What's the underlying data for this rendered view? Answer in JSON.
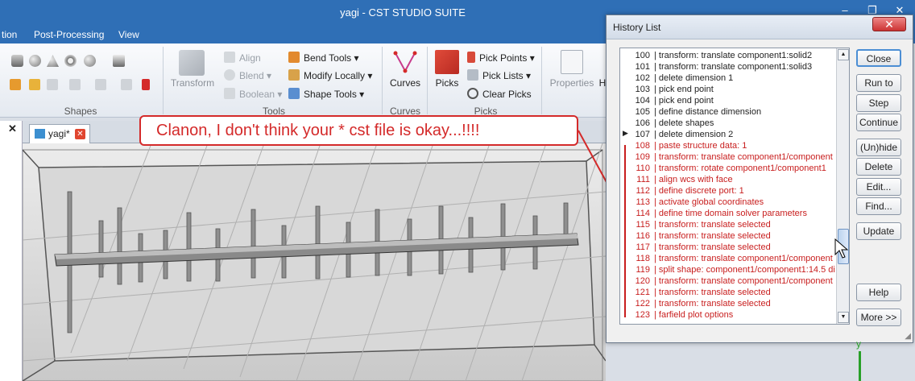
{
  "window": {
    "title": "yagi - CST STUDIO SUITE",
    "minimize": "–",
    "restore": "❐",
    "close": "✕"
  },
  "menu": [
    "tion",
    "Post-Processing",
    "View"
  ],
  "ribbon": {
    "groups": {
      "shapes": "Shapes",
      "tools": "Tools",
      "curves": "Curves",
      "picks": "Picks"
    },
    "transform": "Transform",
    "align": "Align",
    "blend": "Blend",
    "boolean": "Boolean",
    "bend_tools": "Bend Tools",
    "modify_locally": "Modify Locally",
    "shape_tools": "Shape Tools",
    "curves": "Curves",
    "picks": "Picks",
    "pick_points": "Pick Points",
    "pick_lists": "Pick Lists",
    "clear_picks": "Clear Picks",
    "properties": "Properties",
    "cut_label": "H"
  },
  "tab": {
    "label": "yagi*",
    "close": "✕"
  },
  "callout": "Clanon, I don't think your * cst file is okay...!!!!",
  "history": {
    "title": "History List",
    "close_x": "✕",
    "current_marker": "▶",
    "rows": [
      {
        "n": "100",
        "t": "transform: translate component1:solid2",
        "red": false
      },
      {
        "n": "101",
        "t": "transform: translate component1:solid3",
        "red": false
      },
      {
        "n": "102",
        "t": "delete dimension 1",
        "red": false
      },
      {
        "n": "103",
        "t": "pick end point",
        "red": false
      },
      {
        "n": "104",
        "t": "pick end point",
        "red": false
      },
      {
        "n": "105",
        "t": "define distance dimension",
        "red": false
      },
      {
        "n": "106",
        "t": "delete shapes",
        "red": false
      },
      {
        "n": "107",
        "t": "delete dimension 2",
        "red": false
      },
      {
        "n": "108",
        "t": "paste structure data: 1",
        "red": true
      },
      {
        "n": "109",
        "t": "transform: translate component1/component",
        "red": true
      },
      {
        "n": "110",
        "t": "transform: rotate component1/component1",
        "red": true
      },
      {
        "n": "111",
        "t": "align wcs with face",
        "red": true
      },
      {
        "n": "112",
        "t": "define discrete port: 1",
        "red": true
      },
      {
        "n": "113",
        "t": "activate global coordinates",
        "red": true
      },
      {
        "n": "114",
        "t": "define time domain solver parameters",
        "red": true
      },
      {
        "n": "115",
        "t": "transform: translate selected",
        "red": true
      },
      {
        "n": "116",
        "t": "transform: translate selected",
        "red": true
      },
      {
        "n": "117",
        "t": "transform: translate selected",
        "red": true
      },
      {
        "n": "118",
        "t": "transform: translate component1/component",
        "red": true
      },
      {
        "n": "119",
        "t": "split shape: component1/component1:14.5 di",
        "red": true
      },
      {
        "n": "120",
        "t": "transform: translate component1/component",
        "red": true
      },
      {
        "n": "121",
        "t": "transform: translate selected",
        "red": true
      },
      {
        "n": "122",
        "t": "transform: translate selected",
        "red": true
      },
      {
        "n": "123",
        "t": "farfield plot options",
        "red": true
      }
    ],
    "buttons": {
      "close": "Close",
      "run_to": "Run to",
      "step": "Step",
      "continue": "Continue",
      "unhide": "(Un)hide",
      "delete": "Delete",
      "edit": "Edit...",
      "find": "Find...",
      "update": "Update",
      "help": "Help",
      "more": "More >>"
    }
  },
  "axis_label": "y"
}
